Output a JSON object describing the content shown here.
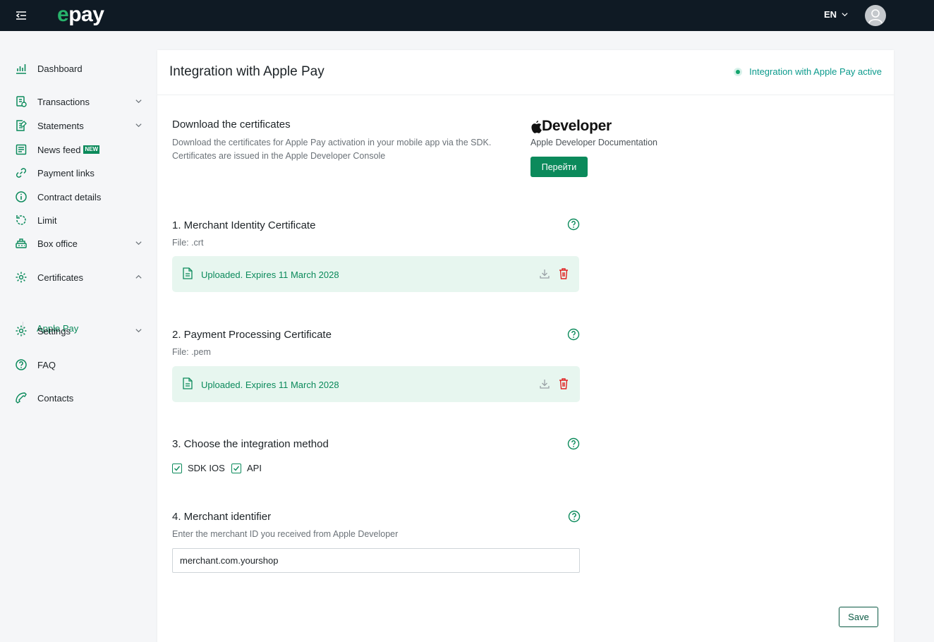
{
  "app": {
    "logo_e": "e",
    "logo_rest": "pay"
  },
  "header": {
    "language": "EN"
  },
  "sidebar": {
    "items": [
      {
        "label": "Dashboard"
      },
      {
        "label": "Transactions"
      },
      {
        "label": "Statements"
      },
      {
        "label": "News feed",
        "badge": "NEW"
      },
      {
        "label": "Payment links"
      },
      {
        "label": "Contract details"
      },
      {
        "label": "Limit"
      },
      {
        "label": "Box office"
      },
      {
        "label": "Certificates"
      },
      {
        "label": "Settings"
      },
      {
        "label": "FAQ"
      },
      {
        "label": "Contacts"
      }
    ],
    "subitem": {
      "label": "Apple Pay"
    }
  },
  "main": {
    "title": "Integration with Apple Pay",
    "status": "Integration with Apple Pay active",
    "download": {
      "title": "Download the certificates",
      "desc_line1": "Download the certificates for Apple Pay activation in your mobile app via the SDK.",
      "desc_line2": "Certificates are issued in the Apple Developer Console"
    },
    "developer": {
      "logo_text": "Developer",
      "doc_label": "Apple Developer Documentation",
      "button": "Перейти"
    },
    "cert1": {
      "title": "1. Merchant Identity Certificate",
      "file": "File: .crt",
      "status": "Uploaded. Expires 11 March 2028"
    },
    "cert2": {
      "title": "2. Payment Processing Certificate",
      "file": "File: .pem",
      "status": "Uploaded. Expires 11 March 2028"
    },
    "method": {
      "title": "3. Choose the integration method",
      "options": [
        {
          "label": "SDK IOS",
          "checked": true
        },
        {
          "label": "API",
          "checked": true
        }
      ]
    },
    "merchant": {
      "title": "4. Merchant identifier",
      "desc": "Enter the merchant ID you received from Apple Developer",
      "value": "merchant.com.yourshop"
    },
    "save": "Save"
  },
  "colors": {
    "brand_green": "#0b8a5b",
    "topbar": "#0f1a24",
    "accent_teal": "#0b9a8c",
    "danger": "#e02020"
  }
}
